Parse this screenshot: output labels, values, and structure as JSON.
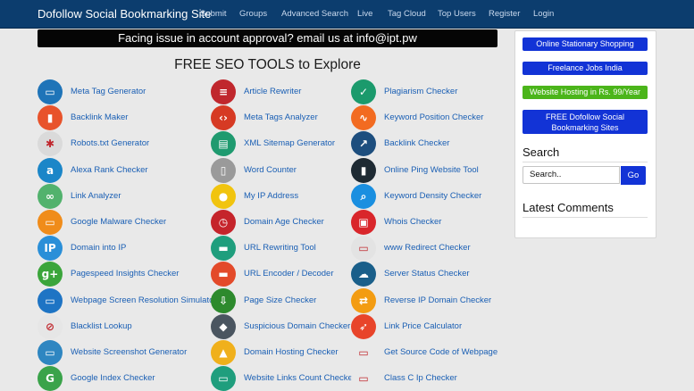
{
  "nav": {
    "brand": "Dofollow Social Bookmarking Site",
    "items": [
      "Submit",
      "Groups",
      "Advanced Search",
      "Live",
      "Tag Cloud",
      "Top Users",
      "Register",
      "Login"
    ]
  },
  "announcement": "Facing issue in account approval? email us at info@ipt.pw",
  "tools_title": "FREE SEO TOOLS to Explore",
  "tools": [
    {
      "label": "Meta Tag Generator",
      "icon": "monitor-icon",
      "color": "#1f74b8",
      "glyph": "▭"
    },
    {
      "label": "Article Rewriter",
      "icon": "document-icon",
      "color": "#c0272d",
      "glyph": "≡"
    },
    {
      "label": "Plagiarism Checker",
      "icon": "puzzle-icon",
      "color": "#1b9a6c",
      "glyph": "✓"
    },
    {
      "label": "Backlink Maker",
      "icon": "chart-icon",
      "color": "#e8532b",
      "glyph": "▮"
    },
    {
      "label": "Meta Tags Analyzer",
      "icon": "code-icon",
      "color": "#d63a24",
      "glyph": "‹›"
    },
    {
      "label": "Keyword Position Checker",
      "icon": "trend-icon",
      "color": "#f26b21",
      "glyph": "∿"
    },
    {
      "label": "Robots.txt Generator",
      "icon": "bug-icon",
      "color": "#dadada",
      "glyph": "✱"
    },
    {
      "label": "XML Sitemap Generator",
      "icon": "sitemap-icon",
      "color": "#1f9a6f",
      "glyph": "▤"
    },
    {
      "label": "Backlink Checker",
      "icon": "graph-icon",
      "color": "#1d4e7e",
      "glyph": "↗"
    },
    {
      "label": "Alexa Rank Checker",
      "icon": "alexa-icon",
      "color": "#1b86c8",
      "glyph": "a"
    },
    {
      "label": "Word Counter",
      "icon": "page-icon",
      "color": "#9a9a9a",
      "glyph": "▯"
    },
    {
      "label": "Online Ping Website Tool",
      "icon": "bars-icon",
      "color": "#1e2a33",
      "glyph": "▮"
    },
    {
      "label": "Link Analyzer",
      "icon": "link-icon",
      "color": "#52b26d",
      "glyph": "∞"
    },
    {
      "label": "My IP Address",
      "icon": "globe-pin-icon",
      "color": "#f1c40f",
      "glyph": "●"
    },
    {
      "label": "Keyword Density Checker",
      "icon": "magnifier-icon",
      "color": "#1a8fe0",
      "glyph": "⌕"
    },
    {
      "label": "Google Malware Checker",
      "icon": "malware-icon",
      "color": "#f08c1a",
      "glyph": "▭"
    },
    {
      "label": "Domain Age Checker",
      "icon": "clock-icon",
      "color": "#c5242b",
      "glyph": "◷"
    },
    {
      "label": "Whois Checker",
      "icon": "lock-icon",
      "color": "#d9262b",
      "glyph": "▣"
    },
    {
      "label": "Domain into IP",
      "icon": "ip-icon",
      "color": "#2a8fd8",
      "glyph": "IP"
    },
    {
      "label": "URL Rewriting Tool",
      "icon": "url-icon",
      "color": "#1f9e7d",
      "glyph": "▬"
    },
    {
      "label": "www Redirect Checker",
      "icon": "browser-icon",
      "color": "#e3e3e3",
      "glyph": "▭"
    },
    {
      "label": "Pagespeed Insights Checker",
      "icon": "gauge-icon",
      "color": "#3ba53b",
      "glyph": "g+"
    },
    {
      "label": "URL Encoder / Decoder",
      "icon": "encoder-icon",
      "color": "#e34a2a",
      "glyph": "▬"
    },
    {
      "label": "Server Status Checker",
      "icon": "cloud-icon",
      "color": "#1a5f8a",
      "glyph": "☁"
    },
    {
      "label": "Webpage Screen Resolution Simulator",
      "icon": "screen-icon",
      "color": "#1e74c4",
      "glyph": "▭"
    },
    {
      "label": "Page Size Checker",
      "icon": "download-icon",
      "color": "#2d8a2d",
      "glyph": "⇩"
    },
    {
      "label": "Reverse IP Domain Checker",
      "icon": "reverse-ip-icon",
      "color": "#f39c12",
      "glyph": "⇄"
    },
    {
      "label": "Blacklist Lookup",
      "icon": "ban-icon",
      "color": "#e6e6e6",
      "glyph": "⊘"
    },
    {
      "label": "Suspicious Domain Checker",
      "icon": "shield-icon",
      "color": "#4a5560",
      "glyph": "◆"
    },
    {
      "label": "Link Price Calculator",
      "icon": "rocket-icon",
      "color": "#e8442a",
      "glyph": "➶"
    },
    {
      "label": "Website Screenshot Generator",
      "icon": "window-icon",
      "color": "#2e86c1",
      "glyph": "▭"
    },
    {
      "label": "Domain Hosting Checker",
      "icon": "hosting-icon",
      "color": "#f0b01c",
      "glyph": "▲"
    },
    {
      "label": "Get Source Code of Webpage",
      "icon": "source-code-icon",
      "color": "#e9e9e9",
      "glyph": "▭"
    },
    {
      "label": "Google Index Checker",
      "icon": "index-icon",
      "color": "#3aa34a",
      "glyph": "G"
    },
    {
      "label": "Website Links Count Checker",
      "icon": "links-count-icon",
      "color": "#1f9e7d",
      "glyph": "▭"
    },
    {
      "label": "Class C Ip Checker",
      "icon": "class-c-icon",
      "color": "#e9e9e9",
      "glyph": "▭"
    }
  ],
  "sidebar": {
    "buttons": [
      {
        "label": "Online Stationary Shopping",
        "style": "blue"
      },
      {
        "label": "Freelance Jobs India",
        "style": "blue"
      },
      {
        "label": "Website Hosting in Rs. 99/Year",
        "style": "green"
      },
      {
        "label": "FREE Dofollow Social Bookmarking Sites",
        "style": "blue"
      }
    ],
    "search_heading": "Search",
    "search_placeholder": "Search..",
    "go_label": "Go",
    "comments_heading": "Latest Comments"
  }
}
